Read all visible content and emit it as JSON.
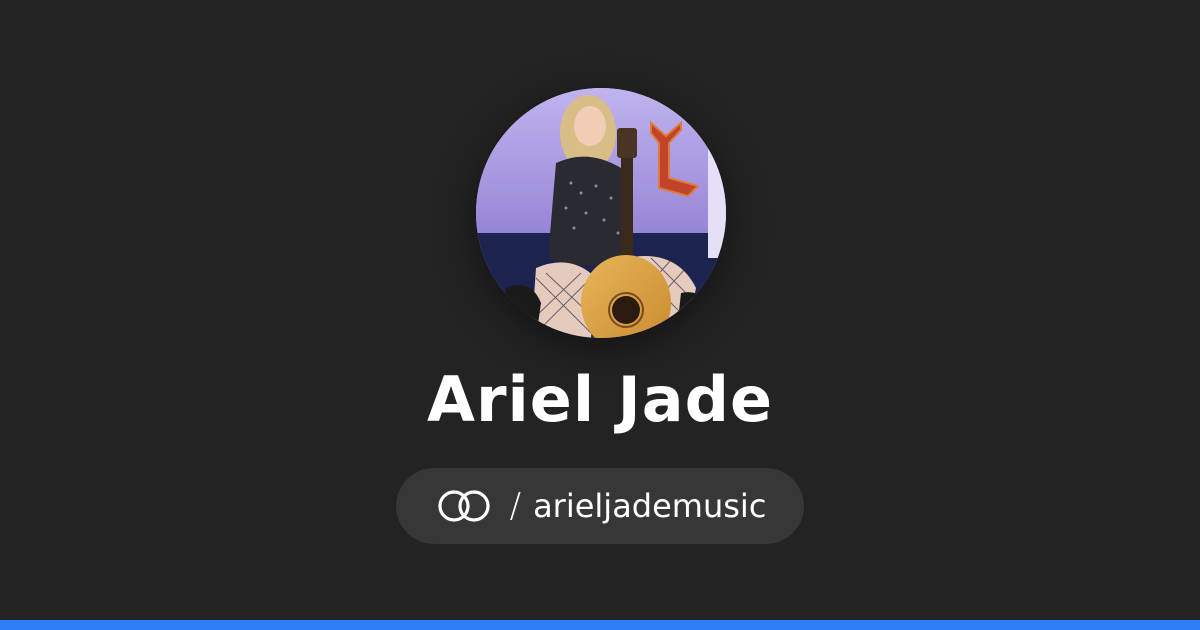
{
  "profile": {
    "name": "Ariel Jade",
    "avatar_alt": "profile-photo"
  },
  "handle": {
    "separator": "/",
    "username": "arieljademusic",
    "icon": "linked-rings-logo-icon"
  },
  "colors": {
    "background": "#232323",
    "pill_background": "#373737",
    "accent_bar": "#2d7df6",
    "text": "#ffffff"
  }
}
